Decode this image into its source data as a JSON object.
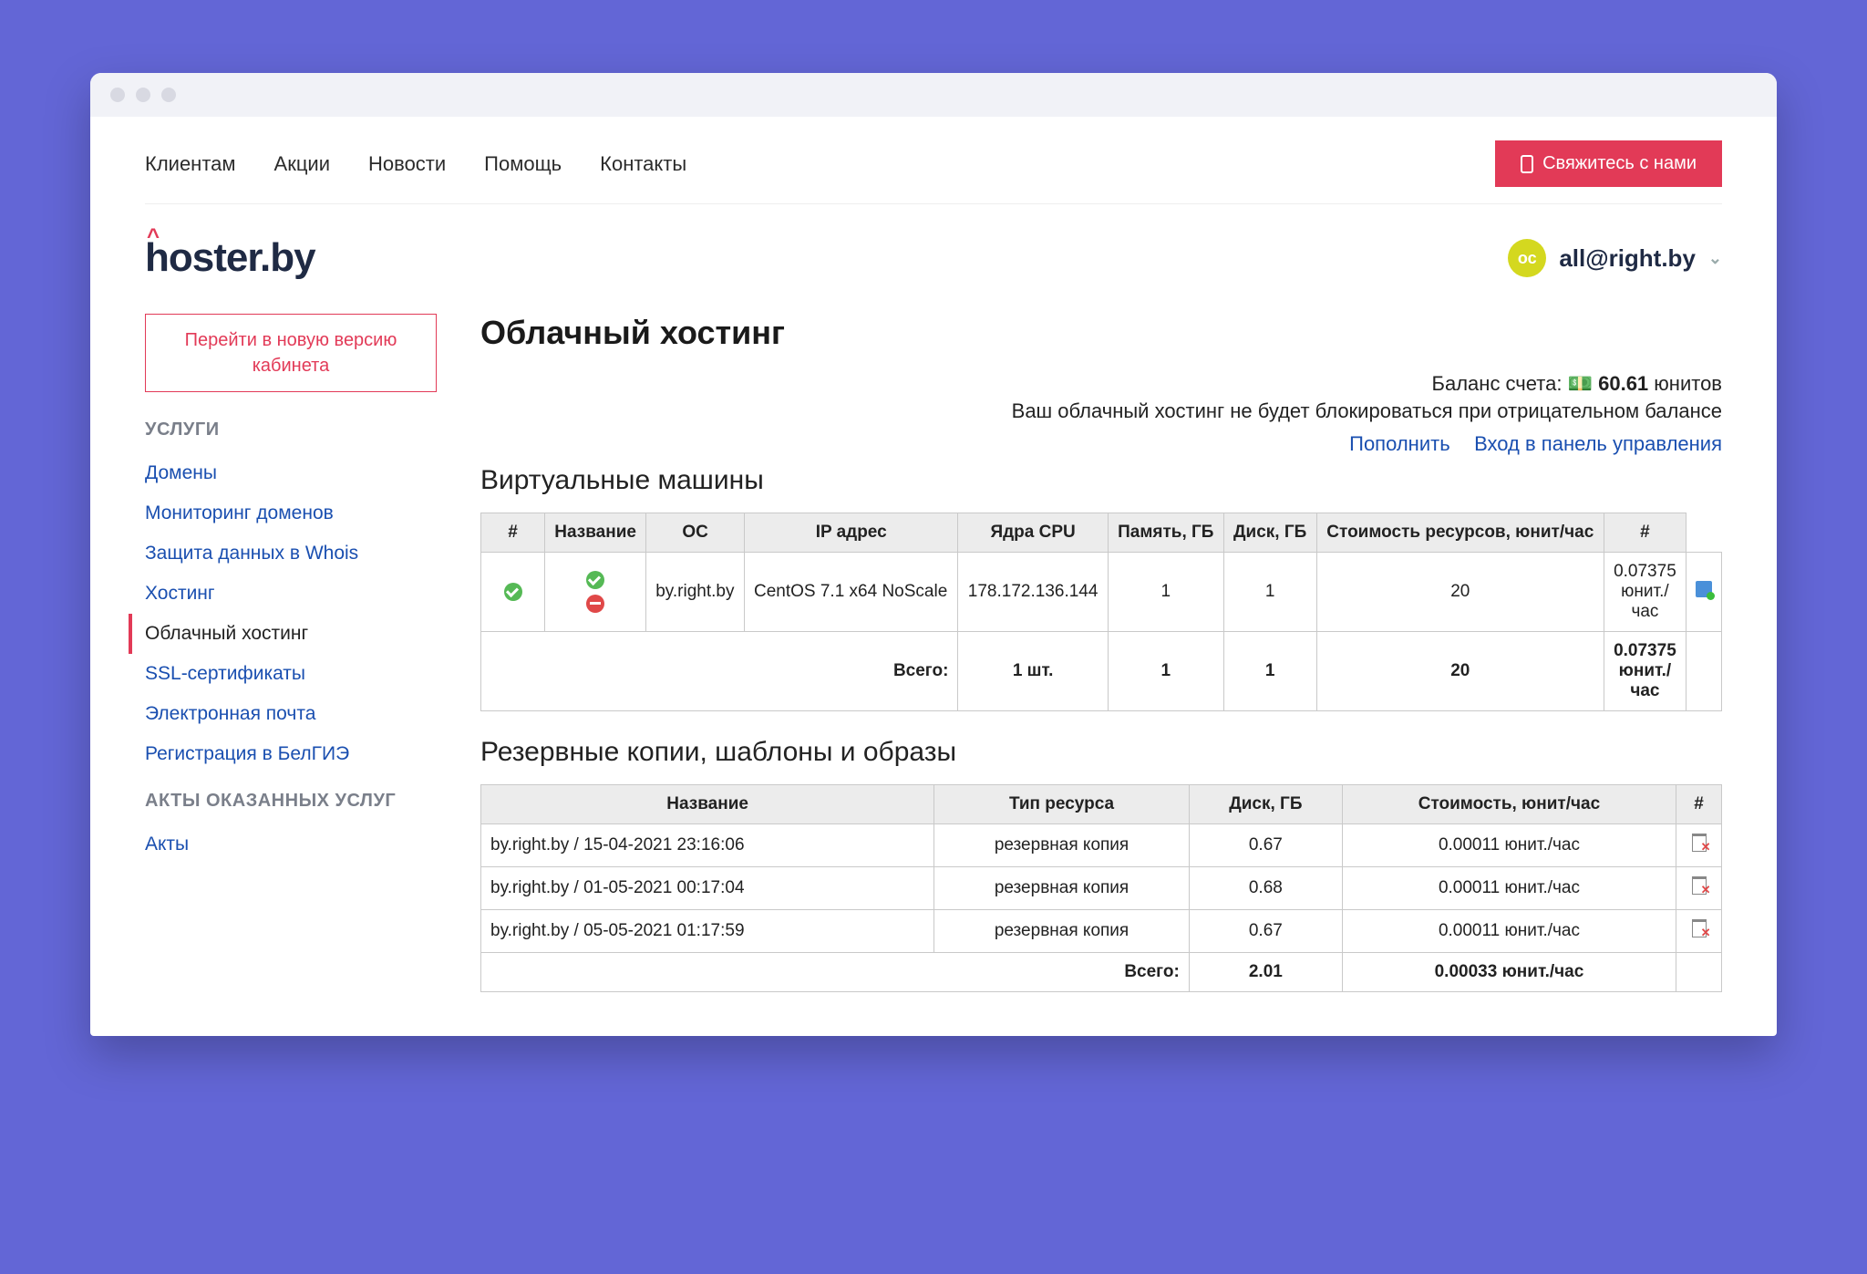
{
  "topnav": {
    "items": [
      "Клиентам",
      "Акции",
      "Новости",
      "Помощь",
      "Контакты"
    ],
    "contact_label": "Свяжитесь с нами"
  },
  "logo": "hoster.by",
  "user": {
    "initials": "ос",
    "email": "all@right.by"
  },
  "sidebar": {
    "new_version_btn": "Перейти в новую версию кабинета",
    "section_services": "УСЛУГИ",
    "items_services": [
      "Домены",
      "Мониторинг доменов",
      "Защита данных в Whois",
      "Хостинг",
      "Облачный хостинг",
      "SSL-сертификаты",
      "Электронная почта",
      "Регистрация в БелГИЭ"
    ],
    "active_index": 4,
    "section_acts": "АКТЫ ОКАЗАННЫХ УСЛУГ",
    "items_acts": [
      "Акты"
    ]
  },
  "main": {
    "title": "Облачный хостинг",
    "balance_label": "Баланс счета:",
    "balance_value": "60.61",
    "balance_unit": "юнитов",
    "status_text": "Ваш облачный хостинг не будет блокироваться при отрицательном балансе",
    "link_topup": "Пополнить",
    "link_panel": "Вход в панель управления",
    "vm_heading": "Виртуальные машины",
    "vm_headers": [
      "#",
      "Название",
      "ОС",
      "IP адрес",
      "Ядра CPU",
      "Память, ГБ",
      "Диск, ГБ",
      "Стоимость ресурсов, юнит/час",
      "#"
    ],
    "vm_rows": [
      {
        "name": "by.right.by",
        "os": "CentOS 7.1 x64 NoScale",
        "ip": "178.172.136.144",
        "cpu": "1",
        "mem": "1",
        "disk": "20",
        "cost": "0.07375 юнит./час"
      }
    ],
    "vm_total_label": "Всего:",
    "vm_total": {
      "count": "1 шт.",
      "cpu": "1",
      "mem": "1",
      "disk": "20",
      "cost": "0.07375 юнит./час"
    },
    "bk_heading": "Резервные копии, шаблоны и образы",
    "bk_headers": [
      "Название",
      "Тип ресурса",
      "Диск, ГБ",
      "Стоимость, юнит/час",
      "#"
    ],
    "bk_rows": [
      {
        "name": "by.right.by / 15-04-2021 23:16:06",
        "type": "резервная копия",
        "disk": "0.67",
        "cost": "0.00011 юнит./час"
      },
      {
        "name": "by.right.by / 01-05-2021 00:17:04",
        "type": "резервная копия",
        "disk": "0.68",
        "cost": "0.00011 юнит./час"
      },
      {
        "name": "by.right.by / 05-05-2021 01:17:59",
        "type": "резервная копия",
        "disk": "0.67",
        "cost": "0.00011 юнит./час"
      }
    ],
    "bk_total_label": "Всего:",
    "bk_total": {
      "disk": "2.01",
      "cost": "0.00033 юнит./час"
    }
  }
}
